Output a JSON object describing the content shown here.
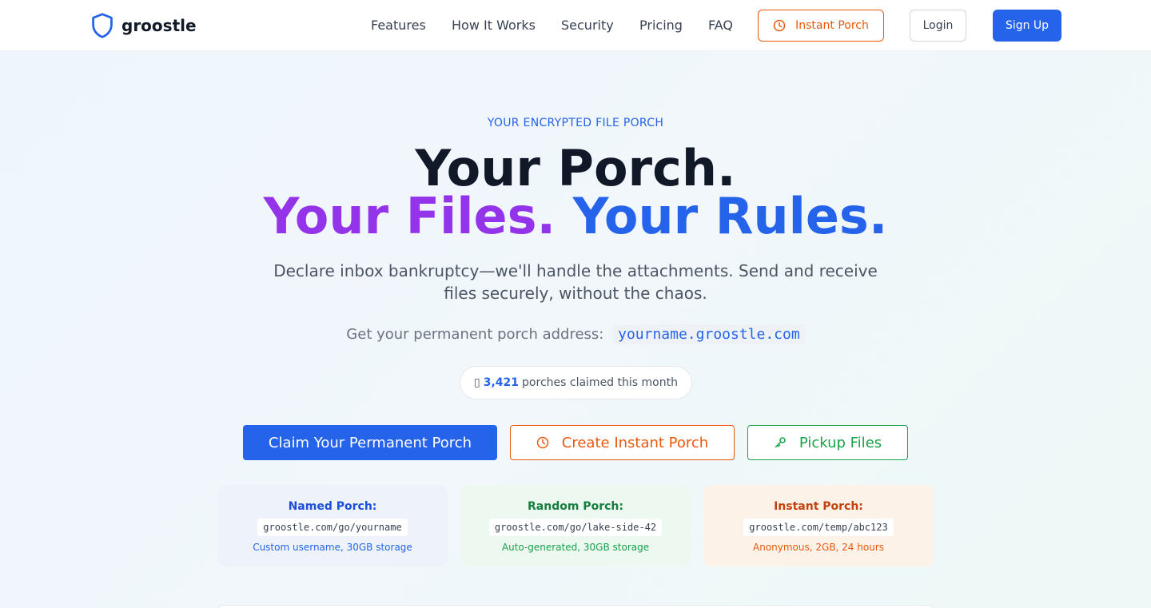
{
  "brand": {
    "name": "groostle",
    "icon": "shield-icon",
    "color": "#2563eb"
  },
  "nav": {
    "links": [
      "Features",
      "How It Works",
      "Security",
      "Pricing",
      "FAQ"
    ],
    "instant_label": "Instant Porch",
    "login_label": "Login",
    "signup_label": "Sign Up"
  },
  "hero": {
    "eyebrow": "YOUR ENCRYPTED FILE PORCH",
    "headline_line1": "Your Porch.",
    "headline_part_files": "Your Files.",
    "headline_part_rules": "Your Rules.",
    "subtext": "Declare inbox bankruptcy—we'll handle the attachments. Send and receive files securely, without the chaos.",
    "address_label": "Get your permanent porch address:",
    "address_value": "yourname.groostle.com",
    "claimed_icon": "▯",
    "claimed_count": "3,421",
    "claimed_text": "porches claimed this month"
  },
  "cta": {
    "claim_label": "Claim Your Permanent Porch",
    "instant_label": "Create Instant Porch",
    "pickup_label": "Pickup Files"
  },
  "cards": {
    "named": {
      "title": "Named Porch:",
      "url": "groostle.com/go/yourname",
      "desc": "Custom username, 30GB storage"
    },
    "random": {
      "title": "Random Porch:",
      "url": "groostle.com/go/lake-side-42",
      "desc": "Auto-generated, 30GB storage"
    },
    "instant": {
      "title": "Instant Porch:",
      "url": "groostle.com/temp/abc123",
      "desc": "Anonymous, 2GB, 24 hours"
    }
  },
  "colors": {
    "primary": "#2563eb",
    "orange": "#ea580c",
    "green": "#16a34a",
    "purple": "#9333ea"
  }
}
